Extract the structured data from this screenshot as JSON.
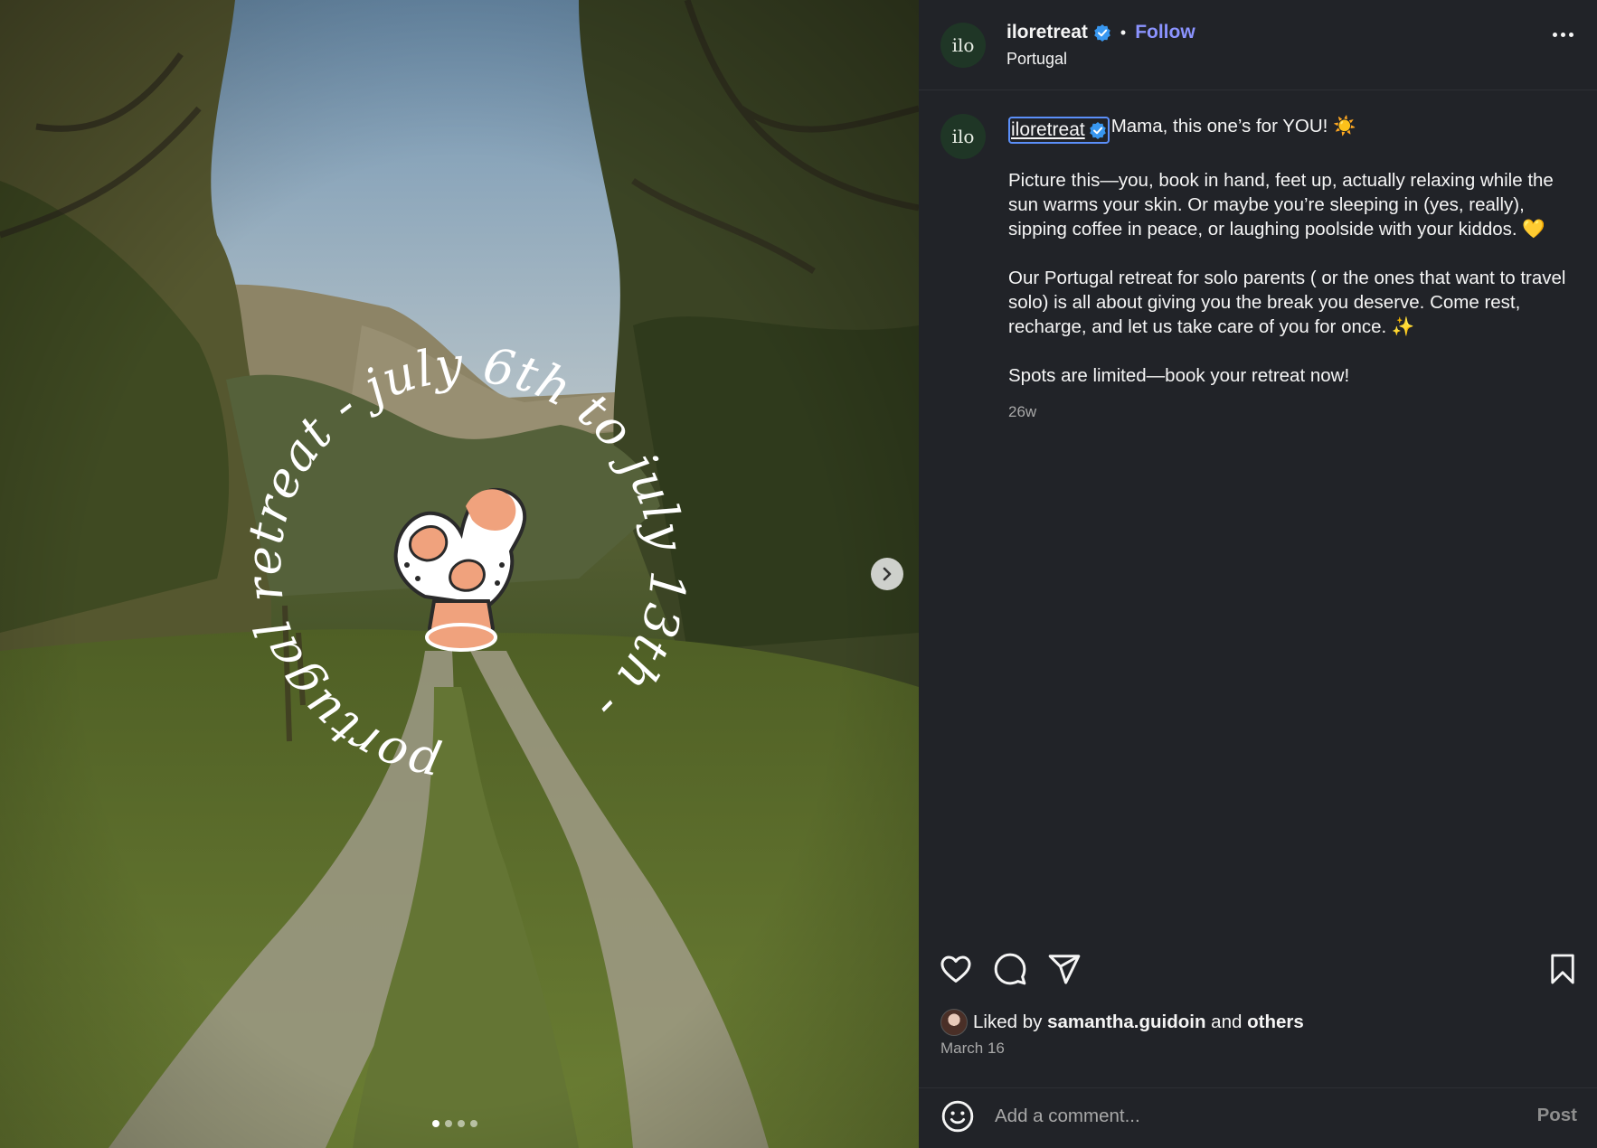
{
  "media": {
    "overlay_text": "portugal retreat - july 6th to july 13th - ",
    "carousel": {
      "count": 4,
      "active_index": 0
    },
    "next_icon": "chevron-right-icon"
  },
  "header": {
    "username": "iloretreat",
    "avatar_text": "ilo",
    "separator": "•",
    "follow_label": "Follow",
    "location": "Portugal",
    "more_icon": "more-horizontal-icon"
  },
  "caption": {
    "avatar_text": "ilo",
    "username": "iloretreat",
    "lines": [
      "Mama, this one’s for YOU! ☀️",
      "Picture this—you, book in hand, feet up, actually relaxing while the sun warms your skin. Or maybe you’re sleeping in (yes, really), sipping coffee in peace, or laughing poolside with your kiddos. 💛",
      "Our Portugal retreat for solo parents ( or the ones that want to travel solo) is all about giving you the break you deserve. Come rest, recharge, and let us take care of you for once. ✨",
      "Spots are limited—book your retreat now!"
    ],
    "age": "26w"
  },
  "actions": {
    "like_icon": "heart-icon",
    "comment_icon": "comment-icon",
    "share_icon": "share-icon",
    "save_icon": "bookmark-icon"
  },
  "likes": {
    "prefix": "Liked by",
    "user": "samantha.guidoin",
    "conjunction": "and",
    "others": "others"
  },
  "date": "March 16",
  "comment": {
    "placeholder": "Add a comment...",
    "post_label": "Post",
    "emoji_icon": "emoji-icon"
  },
  "colors": {
    "background": "#212328",
    "follow": "#8b93ff",
    "verified": "#3897f0",
    "logo_orange": "#f0a27d"
  }
}
